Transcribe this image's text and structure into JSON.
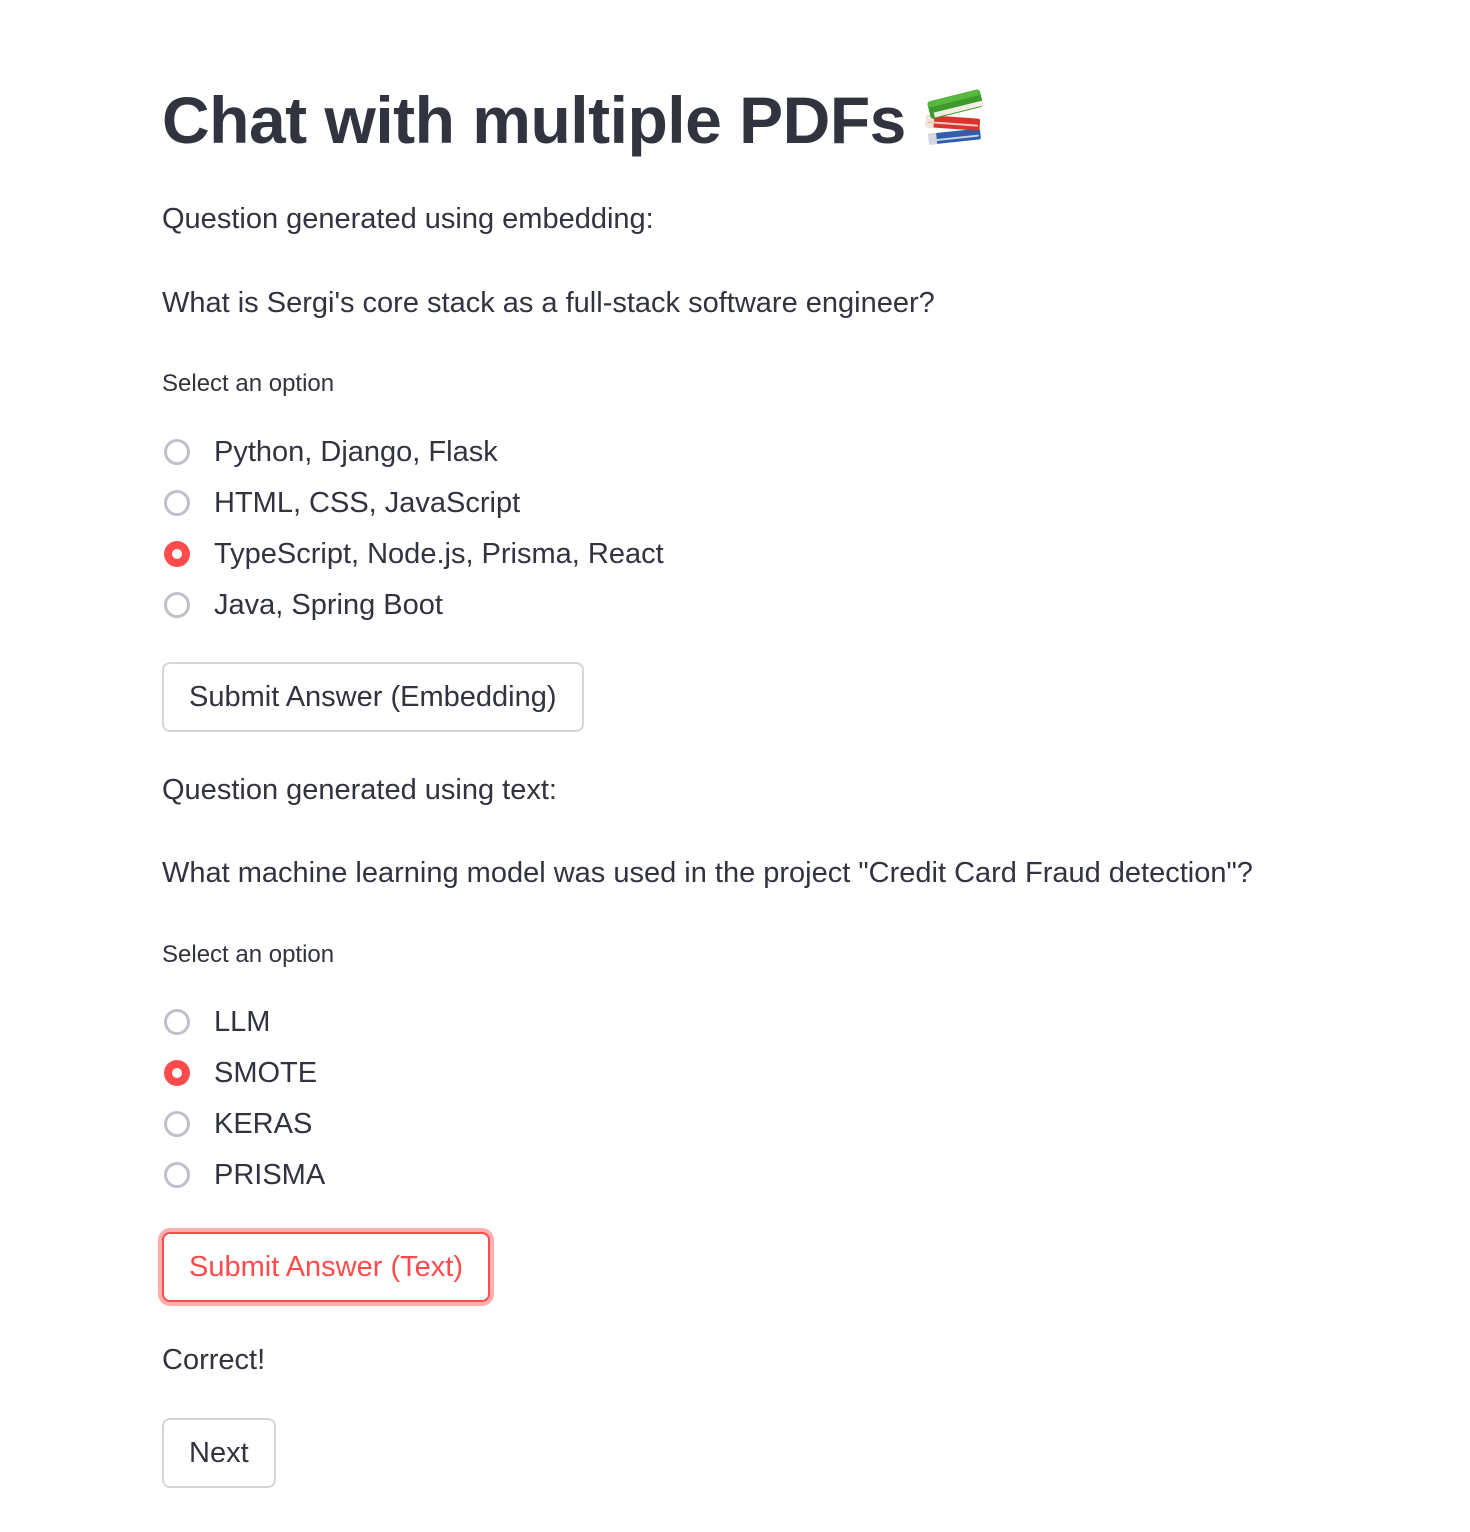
{
  "app": {
    "title": "Chat with multiple PDFs",
    "title_icon": "books-icon"
  },
  "embedding_section": {
    "heading": "Question generated using embedding:",
    "question": "What is Sergi's core stack as a full-stack software engineer?",
    "select_label": "Select an option",
    "options": [
      "Python, Django, Flask",
      "HTML, CSS, JavaScript",
      "TypeScript, Node.js, Prisma, React",
      "Java, Spring Boot"
    ],
    "selected_option": "TypeScript, Node.js, Prisma, React",
    "submit_label": "Submit Answer (Embedding)"
  },
  "text_section": {
    "heading": "Question generated using text:",
    "question": "What machine learning model was used in the project \"Credit Card Fraud detection\"?",
    "select_label": "Select an option",
    "options": [
      "LLM",
      "SMOTE",
      "KERAS",
      "PRISMA"
    ],
    "selected_option": "SMOTE",
    "submit_label": "Submit Answer (Text)"
  },
  "result": {
    "message": "Correct!",
    "next_label": "Next"
  },
  "colors": {
    "accent": "#ff4b4b",
    "text": "#31333f",
    "radio_border": "#bfc1c8",
    "button_border": "#d5d6da",
    "background": "#ffffff"
  }
}
